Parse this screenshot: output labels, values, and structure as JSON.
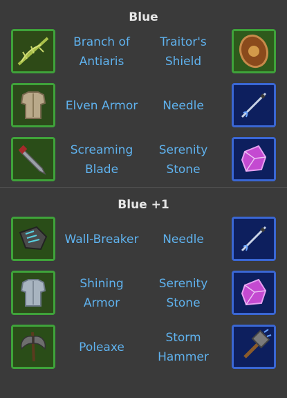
{
  "sections": [
    {
      "title": "Blue",
      "rows": [
        {
          "left": {
            "label": "Branch of Antiaris",
            "icon": "bow-branch-icon"
          },
          "right": {
            "label": "Traitor's Shield",
            "icon": "shield-icon"
          }
        },
        {
          "left": {
            "label": "Elven Armor",
            "icon": "armor-icon"
          },
          "right": {
            "label": "Needle",
            "icon": "needle-icon"
          }
        },
        {
          "left": {
            "label": "Screaming Blade",
            "icon": "blade-icon"
          },
          "right": {
            "label": "Serenity Stone",
            "icon": "gem-icon"
          }
        }
      ]
    },
    {
      "title": "Blue +1",
      "rows": [
        {
          "left": {
            "label": "Wall-Breaker",
            "icon": "gauntlet-icon"
          },
          "right": {
            "label": "Needle",
            "icon": "needle-icon"
          }
        },
        {
          "left": {
            "label": "Shining Armor",
            "icon": "armor-icon"
          },
          "right": {
            "label": "Serenity Stone",
            "icon": "gem-icon"
          }
        },
        {
          "left": {
            "label": "Poleaxe",
            "icon": "axe-icon"
          },
          "right": {
            "label": "Storm Hammer",
            "icon": "hammer-icon"
          }
        }
      ]
    }
  ],
  "colors": {
    "background": "#3a3a3a",
    "title": "#e6e6e6",
    "label": "#5fb2ee",
    "green_frame": "#3fa33a",
    "blue_frame": "#3a67d4"
  }
}
